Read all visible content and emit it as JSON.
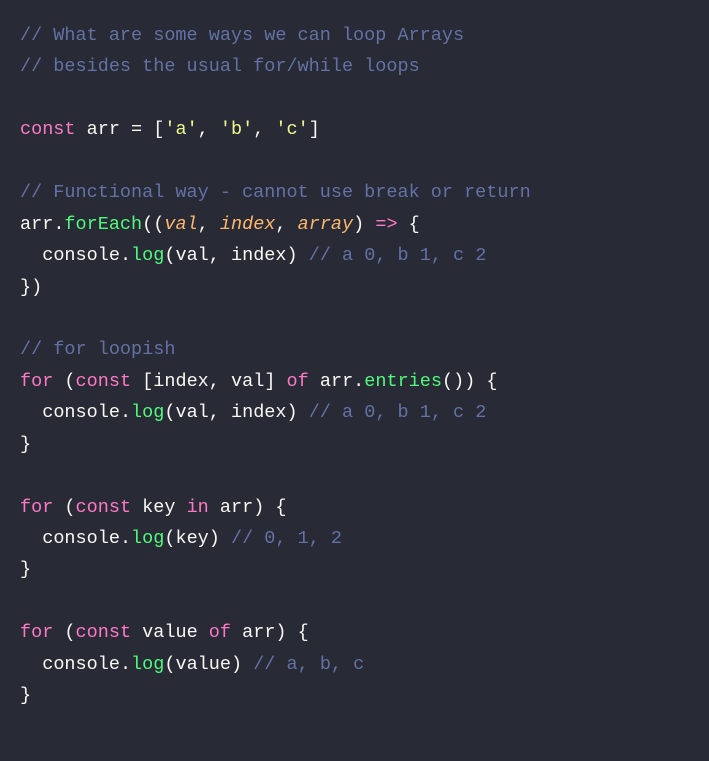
{
  "lines": {
    "c1": "// What are some ways we can loop Arrays",
    "c2": "// besides the usual for/while loops",
    "l1_const": "const",
    "l1_arr": "arr",
    "l1_eq": " = [",
    "l1_a": "'a'",
    "l1_comma1": ", ",
    "l1_b": "'b'",
    "l1_comma2": ", ",
    "l1_c": "'c'",
    "l1_close": "]",
    "c3": "// Functional way - cannot use break or return",
    "l2_arr": "arr",
    "l2_dot": ".",
    "l2_foreach": "forEach",
    "l2_open": "((",
    "l2_val": "val",
    "l2_c1": ", ",
    "l2_index": "index",
    "l2_c2": ", ",
    "l2_array": "array",
    "l2_close": ") ",
    "l2_arrow": "=>",
    "l2_brace": " {",
    "l3_indent": "  ",
    "l3_console": "console",
    "l3_dot": ".",
    "l3_log": "log",
    "l3_open": "(",
    "l3_val": "val",
    "l3_comma": ", ",
    "l3_index": "index",
    "l3_close": ") ",
    "l3_comment": "// a 0, b 1, c 2",
    "l4": "})",
    "c4": "// for loopish",
    "l5_for": "for",
    "l5_sp": " (",
    "l5_const": "const",
    "l5_sp2": " [",
    "l5_index": "index",
    "l5_comma": ", ",
    "l5_val": "val",
    "l5_close": "] ",
    "l5_of": "of",
    "l5_sp3": " ",
    "l5_arr": "arr",
    "l5_dot": ".",
    "l5_entries": "entries",
    "l5_call": "()) {",
    "l6_indent": "  ",
    "l6_console": "console",
    "l6_dot": ".",
    "l6_log": "log",
    "l6_open": "(",
    "l6_val": "val",
    "l6_comma": ", ",
    "l6_index": "index",
    "l6_close": ") ",
    "l6_comment": "// a 0, b 1, c 2",
    "l7": "}",
    "l8_for": "for",
    "l8_sp": " (",
    "l8_const": "const",
    "l8_sp2": " ",
    "l8_key": "key",
    "l8_sp3": " ",
    "l8_in": "in",
    "l8_sp4": " ",
    "l8_arr": "arr",
    "l8_close": ") {",
    "l9_indent": "  ",
    "l9_console": "console",
    "l9_dot": ".",
    "l9_log": "log",
    "l9_open": "(",
    "l9_key": "key",
    "l9_close": ") ",
    "l9_comment": "// 0, 1, 2",
    "l10": "}",
    "l11_for": "for",
    "l11_sp": " (",
    "l11_const": "const",
    "l11_sp2": " ",
    "l11_value": "value",
    "l11_sp3": " ",
    "l11_of": "of",
    "l11_sp4": " ",
    "l11_arr": "arr",
    "l11_close": ") {",
    "l12_indent": "  ",
    "l12_console": "console",
    "l12_dot": ".",
    "l12_log": "log",
    "l12_open": "(",
    "l12_value": "value",
    "l12_close": ") ",
    "l12_comment": "// a, b, c",
    "l13": "}"
  }
}
